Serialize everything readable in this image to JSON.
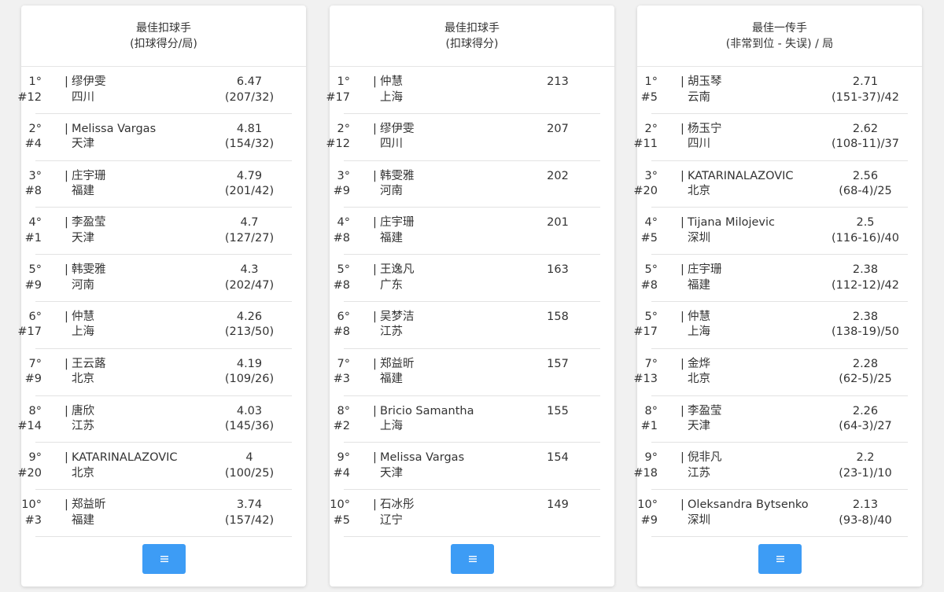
{
  "cards": [
    {
      "title": "最佳扣球手",
      "subtitle": "(扣球得分/局)",
      "rows": [
        {
          "rank": "1°",
          "num": "#12",
          "name": "缪伊雯",
          "team": "四川",
          "value": "6.47",
          "sub": "(207/32)"
        },
        {
          "rank": "2°",
          "num": "#4",
          "name": "Melissa Vargas",
          "team": "天津",
          "value": "4.81",
          "sub": "(154/32)"
        },
        {
          "rank": "3°",
          "num": "#8",
          "name": "庄宇珊",
          "team": "福建",
          "value": "4.79",
          "sub": "(201/42)"
        },
        {
          "rank": "4°",
          "num": "#1",
          "name": "李盈莹",
          "team": "天津",
          "value": "4.7",
          "sub": "(127/27)"
        },
        {
          "rank": "5°",
          "num": "#9",
          "name": "韩雯雅",
          "team": "河南",
          "value": "4.3",
          "sub": "(202/47)"
        },
        {
          "rank": "6°",
          "num": "#17",
          "name": "仲慧",
          "team": "上海",
          "value": "4.26",
          "sub": "(213/50)"
        },
        {
          "rank": "7°",
          "num": "#9",
          "name": "王云蕗",
          "team": "北京",
          "value": "4.19",
          "sub": "(109/26)"
        },
        {
          "rank": "8°",
          "num": "#14",
          "name": "唐欣",
          "team": "江苏",
          "value": "4.03",
          "sub": "(145/36)"
        },
        {
          "rank": "9°",
          "num": "#20",
          "name": "KATARINALAZOVIC",
          "team": "北京",
          "value": "4",
          "sub": "(100/25)"
        },
        {
          "rank": "10°",
          "num": "#3",
          "name": "郑益昕",
          "team": "福建",
          "value": "3.74",
          "sub": "(157/42)"
        }
      ]
    },
    {
      "title": "最佳扣球手",
      "subtitle": "(扣球得分)",
      "rows": [
        {
          "rank": "1°",
          "num": "#17",
          "name": "仲慧",
          "team": "上海",
          "value": "213",
          "sub": ""
        },
        {
          "rank": "2°",
          "num": "#12",
          "name": "缪伊雯",
          "team": "四川",
          "value": "207",
          "sub": ""
        },
        {
          "rank": "3°",
          "num": "#9",
          "name": "韩雯雅",
          "team": "河南",
          "value": "202",
          "sub": ""
        },
        {
          "rank": "4°",
          "num": "#8",
          "name": "庄宇珊",
          "team": "福建",
          "value": "201",
          "sub": ""
        },
        {
          "rank": "5°",
          "num": "#8",
          "name": "王逸凡",
          "team": "广东",
          "value": "163",
          "sub": ""
        },
        {
          "rank": "6°",
          "num": "#8",
          "name": "吴梦洁",
          "team": "江苏",
          "value": "158",
          "sub": ""
        },
        {
          "rank": "7°",
          "num": "#3",
          "name": "郑益昕",
          "team": "福建",
          "value": "157",
          "sub": ""
        },
        {
          "rank": "8°",
          "num": "#2",
          "name": "Bricio Samantha",
          "team": "上海",
          "value": "155",
          "sub": ""
        },
        {
          "rank": "9°",
          "num": "#4",
          "name": "Melissa Vargas",
          "team": "天津",
          "value": "154",
          "sub": ""
        },
        {
          "rank": "10°",
          "num": "#5",
          "name": "石冰彤",
          "team": "辽宁",
          "value": "149",
          "sub": ""
        }
      ]
    },
    {
      "title": "最佳一传手",
      "subtitle": "(非常到位 - 失误) / 局",
      "rows": [
        {
          "rank": "1°",
          "num": "#5",
          "name": "胡玉琴",
          "team": "云南",
          "value": "2.71",
          "sub": "(151-37)/42"
        },
        {
          "rank": "2°",
          "num": "#11",
          "name": "杨玉宁",
          "team": "四川",
          "value": "2.62",
          "sub": "(108-11)/37"
        },
        {
          "rank": "3°",
          "num": "#20",
          "name": "KATARINALAZOVIC",
          "team": "北京",
          "value": "2.56",
          "sub": "(68-4)/25"
        },
        {
          "rank": "4°",
          "num": "#5",
          "name": "Tijana Milojevic",
          "team": "深圳",
          "value": "2.5",
          "sub": "(116-16)/40"
        },
        {
          "rank": "5°",
          "num": "#8",
          "name": "庄宇珊",
          "team": "福建",
          "value": "2.38",
          "sub": "(112-12)/42"
        },
        {
          "rank": "5°",
          "num": "#17",
          "name": "仲慧",
          "team": "上海",
          "value": "2.38",
          "sub": "(138-19)/50"
        },
        {
          "rank": "7°",
          "num": "#13",
          "name": "金烨",
          "team": "北京",
          "value": "2.28",
          "sub": "(62-5)/25"
        },
        {
          "rank": "8°",
          "num": "#1",
          "name": "李盈莹",
          "team": "天津",
          "value": "2.26",
          "sub": "(64-3)/27"
        },
        {
          "rank": "9°",
          "num": "#18",
          "name": "倪非凡",
          "team": "江苏",
          "value": "2.2",
          "sub": "(23-1)/10"
        },
        {
          "rank": "10°",
          "num": "#9",
          "name": "Oleksandra Bytsenko",
          "team": "深圳",
          "value": "2.13",
          "sub": "(93-8)/40"
        }
      ]
    }
  ],
  "menu_button": {
    "icon": "menu-icon"
  },
  "colors": {
    "accent": "#3d9cf5",
    "background": "#f1f1f1",
    "text": "#333333",
    "divider": "#e3e3e3"
  }
}
